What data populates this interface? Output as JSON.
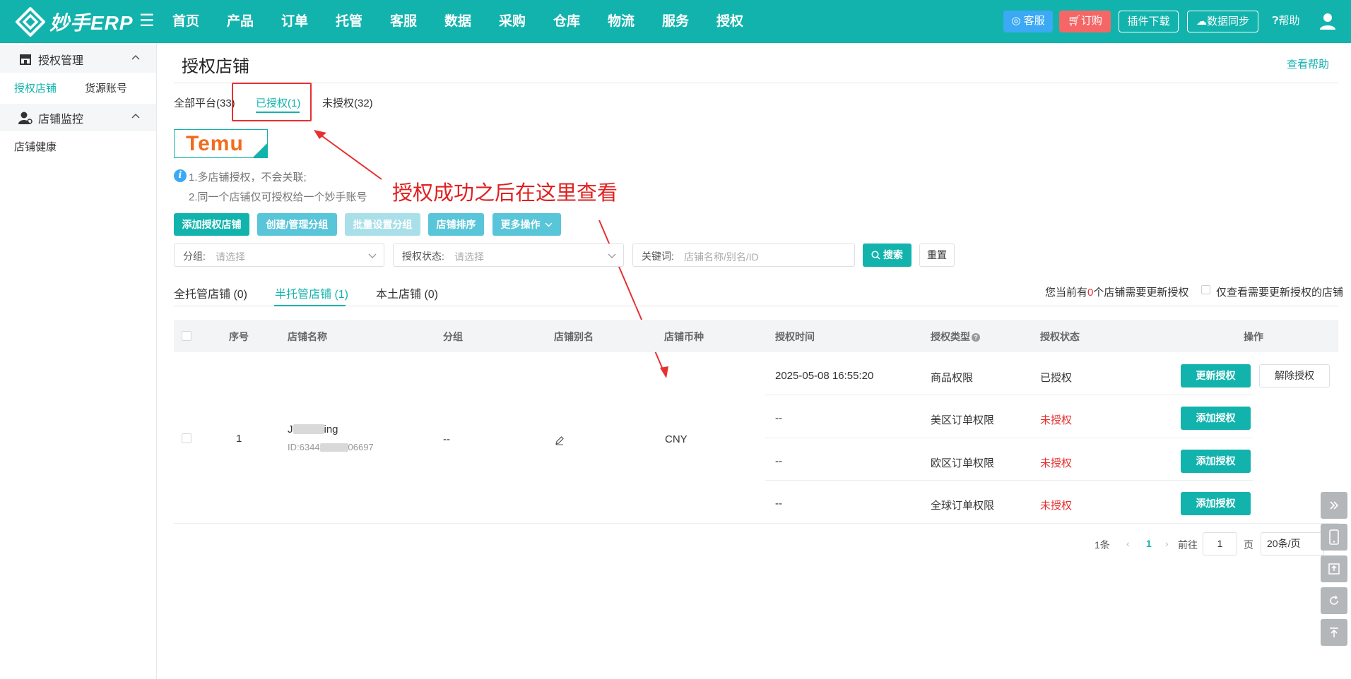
{
  "app": {
    "logo_text": "妙手ERP",
    "nav": [
      "首页",
      "产品",
      "订单",
      "托管",
      "客服",
      "数据",
      "采购",
      "仓库",
      "物流",
      "服务",
      "授权"
    ],
    "kefu_label": "客服",
    "order_label": "订购",
    "plugin_label": "插件下载",
    "sync_label": "数据同步",
    "help_label": "帮助"
  },
  "sidebar": {
    "groups": [
      {
        "label": "授权管理",
        "items": [
          "授权店铺",
          "货源账号"
        ]
      },
      {
        "label": "店铺监控",
        "items": [
          "店铺健康"
        ]
      }
    ]
  },
  "page": {
    "title": "授权店铺",
    "help_link": "查看帮助",
    "platform_tabs": [
      "全部平台(33)",
      "已授权(1)",
      "未授权(32)"
    ],
    "platform_badge": "Temu",
    "notes": [
      "1.多店铺授权，不会关联;",
      "2.同一个店铺仅可授权给一个妙手账号"
    ],
    "annotation": "授权成功之后在这里查看",
    "actions": [
      "添加授权店铺",
      "创建/管理分组",
      "批量设置分组",
      "店铺排序",
      "更多操作"
    ],
    "filters": {
      "group_label": "分组:",
      "group_placeholder": "请选择",
      "status_label": "授权状态:",
      "status_placeholder": "请选择",
      "keyword_label": "关键词:",
      "keyword_placeholder": "店铺名称/别名/ID",
      "search_label": "搜索",
      "reset_label": "重置"
    },
    "store_tabs": [
      "全托管店铺 (0)",
      "半托管店铺 (1)",
      "本土店铺 (0)"
    ],
    "notice_prefix": "您当前有",
    "notice_count": "0",
    "notice_suffix": "个店铺需要更新授权",
    "only_update_label": "仅查看需要更新授权的店铺"
  },
  "table": {
    "headers": [
      "序号",
      "店铺名称",
      "分组",
      "店铺别名",
      "店铺币种",
      "授权时间",
      "授权类型",
      "授权状态",
      "操作"
    ],
    "rows": [
      {
        "index": "1",
        "store_name_start": "J",
        "store_name_end": "ing",
        "store_id_start": "ID:6344",
        "store_id_end": "06697",
        "group": "--",
        "currency": "CNY",
        "auths": [
          {
            "time": "2025-05-08 16:55:20",
            "type": "商品权限",
            "status": "已授权",
            "actions": [
              "更新授权",
              "解除授权"
            ]
          },
          {
            "time": "--",
            "type": "美区订单权限",
            "status": "未授权",
            "actions": [
              "添加授权"
            ]
          },
          {
            "time": "--",
            "type": "欧区订单权限",
            "status": "未授权",
            "actions": [
              "添加授权"
            ]
          },
          {
            "time": "--",
            "type": "全球订单权限",
            "status": "未授权",
            "actions": [
              "添加授权"
            ]
          }
        ]
      }
    ]
  },
  "pagination": {
    "total": "1条",
    "current": "1",
    "goto_label": "前往",
    "goto_value": "1",
    "page_label": "页",
    "size": "20条/页"
  },
  "colors": {
    "primary": "#13b3ad",
    "danger": "#e83030",
    "info": "#3ba9f3"
  }
}
